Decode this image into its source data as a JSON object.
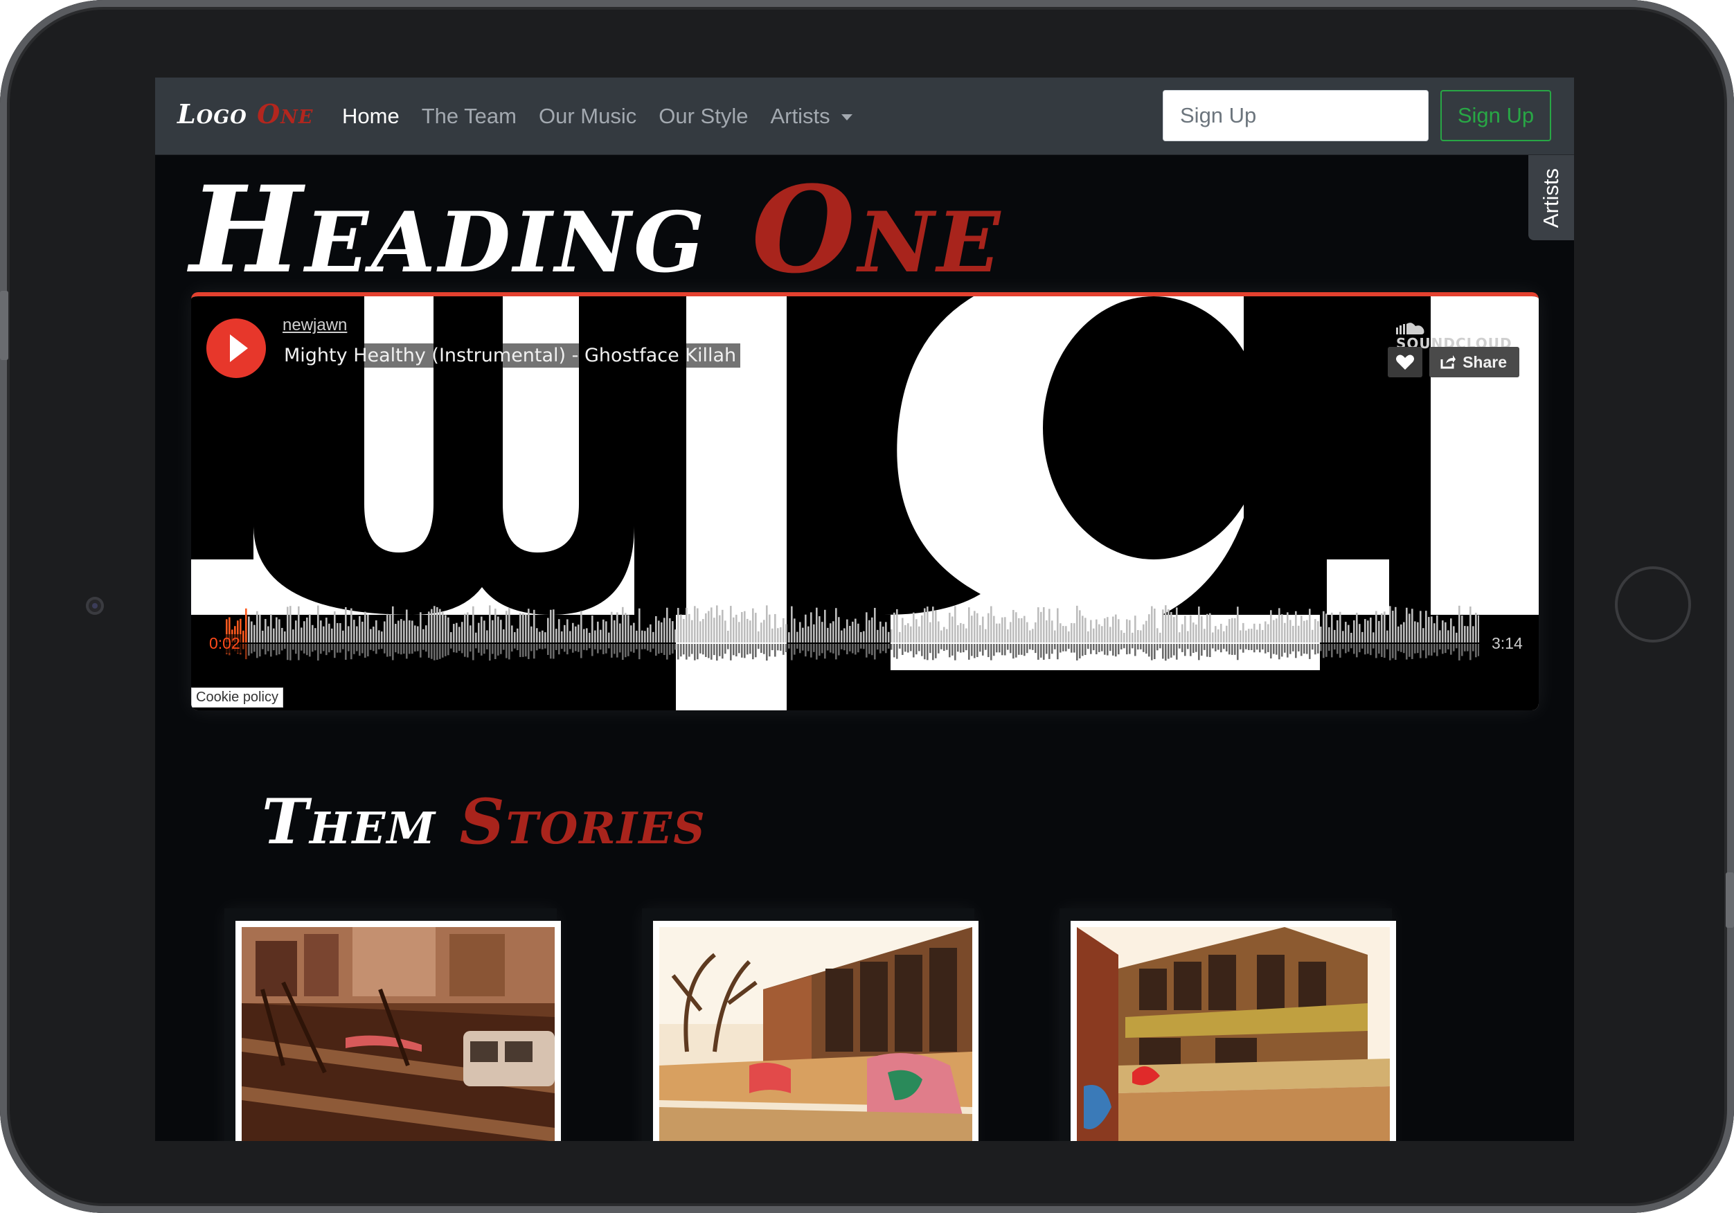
{
  "navbar": {
    "brand": {
      "part1": "Logo",
      "part2": "One"
    },
    "links": [
      "Home",
      "The Team",
      "Our Music",
      "Our Style",
      "Artists"
    ],
    "signup_placeholder": "Sign Up",
    "signup_button": "Sign Up"
  },
  "side_tab": {
    "label": "Artists"
  },
  "page_heading": {
    "part1": "Heading",
    "part2": "One"
  },
  "player": {
    "uploader": "newjawn",
    "track_title": "Mighty Healthy (Instrumental) - Ghostface Killah",
    "brand": "SOUNDCLOUD",
    "share_label": "Share",
    "time_current": "0:02",
    "time_total": "3:14",
    "cookie_label": "Cookie policy",
    "accent_color": "#e4412f"
  },
  "section_heading": {
    "part1": "Them",
    "part2": "Stories"
  },
  "colors": {
    "brand_red": "#a8241c",
    "success_green": "#28a745",
    "navbar_bg": "#343a40"
  }
}
